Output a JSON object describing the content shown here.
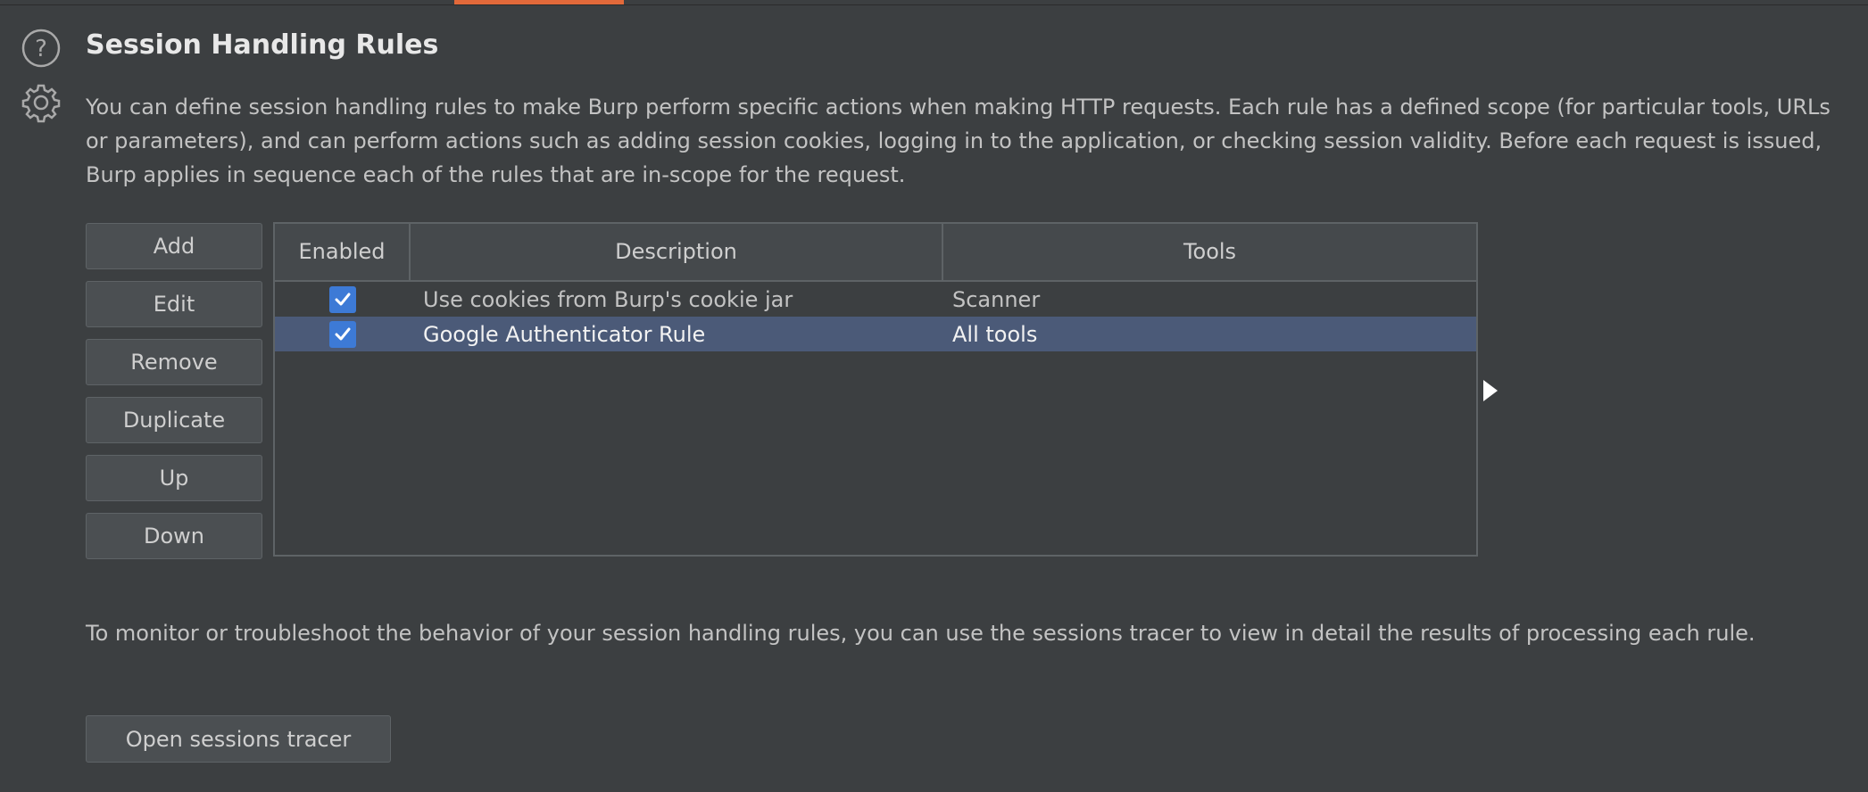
{
  "section": {
    "title": "Session Handling Rules",
    "description": "You can define session handling rules to make Burp perform specific actions when making HTTP requests. Each rule has a defined scope (for particular tools, URLs or parameters), and can perform actions such as adding session cookies, logging in to the application, or checking session validity. Before each request is issued, Burp applies in sequence each of the rules that are in-scope for the request."
  },
  "buttons": {
    "add": "Add",
    "edit": "Edit",
    "remove": "Remove",
    "duplicate": "Duplicate",
    "up": "Up",
    "down": "Down"
  },
  "table": {
    "columns": {
      "enabled": "Enabled",
      "description": "Description",
      "tools": "Tools"
    },
    "rows": [
      {
        "enabled": true,
        "description": "Use cookies from Burp's cookie jar",
        "tools": "Scanner",
        "selected": false
      },
      {
        "enabled": true,
        "description": "Google Authenticator Rule",
        "tools": "All tools",
        "selected": true
      }
    ]
  },
  "tracer": {
    "text": "To monitor or troubleshoot the behavior of your session handling rules, you can use the sessions tracer to view in detail the results of processing each rule.",
    "button": "Open sessions tracer"
  },
  "colors": {
    "background": "#3c3f41",
    "accent_tab": "#e2693a",
    "selection": "#4b5a78",
    "checkbox": "#3d7ad6"
  }
}
